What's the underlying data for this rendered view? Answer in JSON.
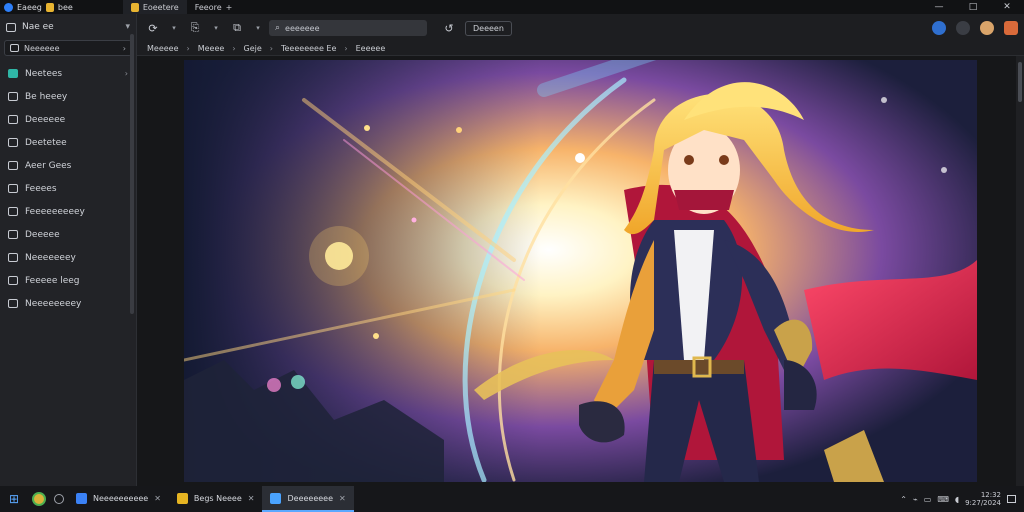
{
  "titlebar": {
    "app_name": "Eaeeg",
    "second_label": "bee",
    "tab_title": "Eoeetere",
    "tab_second": "Feeore",
    "new_tab": "+",
    "minimize": "—",
    "maximize": "□",
    "close": "✕"
  },
  "sidebar": {
    "header_label": "Nae ee",
    "search_label": "Neeeeee",
    "search_arrow": "›",
    "items": [
      {
        "label": "Neetees",
        "icon": "teal-folder-icon",
        "highlight": true,
        "chev": "›"
      },
      {
        "label": "Be heeey"
      },
      {
        "label": "Deeeeee"
      },
      {
        "label": "Deetetee"
      },
      {
        "label": "Aeer Gees"
      },
      {
        "label": "Feeees"
      },
      {
        "label": "Feeeeeeeeey"
      },
      {
        "label": "Deeeee"
      },
      {
        "label": "Neeeeeeey"
      },
      {
        "label": "Feeeee leeg"
      },
      {
        "label": "Neeeeeeeey"
      }
    ]
  },
  "toolbar": {
    "address_text": "eeeeeee",
    "open_button": "Deeeen",
    "back": "↺",
    "caret": "▾"
  },
  "breadcrumb": {
    "items": [
      "Meeeee",
      "Meeee",
      "Geje",
      "Teeeeeeee Ee",
      "Eeeeee"
    ],
    "separator": "›"
  },
  "taskbar": {
    "apps": [
      {
        "label": "Neeeeeeeeee",
        "color": "#3b82f6",
        "active": false
      },
      {
        "label": "Begs Neeee",
        "color": "#e6b422",
        "active": false
      },
      {
        "label": "Deeeeeeee",
        "color": "#4aa3ff",
        "active": true
      }
    ],
    "close_glyph": "✕",
    "clock_time": "12:32",
    "clock_date": "9:27/2024"
  },
  "colors": {
    "accent": "#5aa8ff",
    "teal": "#2fb6a6",
    "panel": "#222327"
  }
}
